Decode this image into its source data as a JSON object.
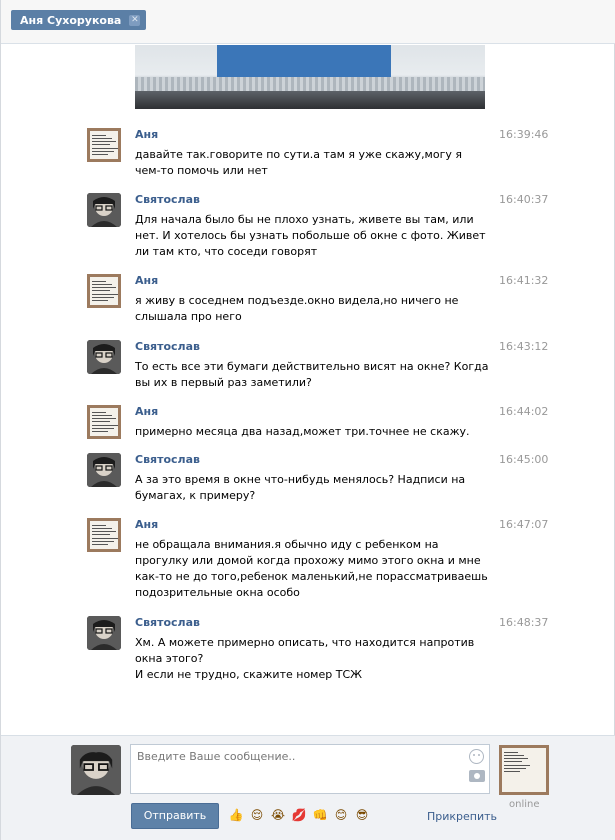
{
  "header": {
    "tab_title": "Аня Сухорукова",
    "tab_close": "✕"
  },
  "messages": [
    {
      "author": "Аня",
      "avatar": "note-avatar",
      "time": "16:39:46",
      "text": "давайте так.говорите по сути.а там я уже скажу,могу я чем-то помочь или нет"
    },
    {
      "author": "Святослав",
      "avatar": "man-avatar",
      "time": "16:40:37",
      "text": "Для начала было бы не плохо узнать, живете вы там, или нет. И хотелось бы узнать побольше об окне с фото. Живет ли там кто, что соседи говорят"
    },
    {
      "author": "Аня",
      "avatar": "note-avatar",
      "time": "16:41:32",
      "text": "я живу в соседнем подъезде.окно видела,но ничего не слышала про него"
    },
    {
      "author": "Святослав",
      "avatar": "man-avatar",
      "time": "16:43:12",
      "text": "То есть все эти бумаги действительно висят на окне? Когда вы их в первый раз заметили?"
    },
    {
      "author": "Аня",
      "avatar": "note-avatar",
      "time": "16:44:02",
      "text": "примерно месяца два назад,может три.точнее не скажу."
    },
    {
      "author": "Святослав",
      "avatar": "man-avatar",
      "time": "16:45:00",
      "text": "А за это время в окне что-нибудь менялось? Надписи на бумагах, к примеру?"
    },
    {
      "author": "Аня",
      "avatar": "note-avatar",
      "time": "16:47:07",
      "text": "не обращала внимания.я обычно иду с ребенком на прогулку или домой когда прохожу мимо этого окна и мне как-то не до того,ребенок маленький,не порассматриваешь подозрительные окна особо"
    },
    {
      "author": "Святослав",
      "avatar": "man-avatar",
      "time": "16:48:37",
      "text": "Хм. А можете примерно описать, что находится напротив окна этого?\nИ если не трудно, скажите номер ТСЖ"
    }
  ],
  "compose": {
    "placeholder": "Введите Ваше сообщение..",
    "send_label": "Отправить",
    "attach_label": "Прикрепить",
    "peer_status": "online",
    "emojis": [
      "👍",
      "😌",
      "😭",
      "💋",
      "👊",
      "😊",
      "😎"
    ]
  },
  "colors": {
    "accent": "#5b7fa6",
    "author": "#3b5e8d",
    "time": "#999999"
  }
}
